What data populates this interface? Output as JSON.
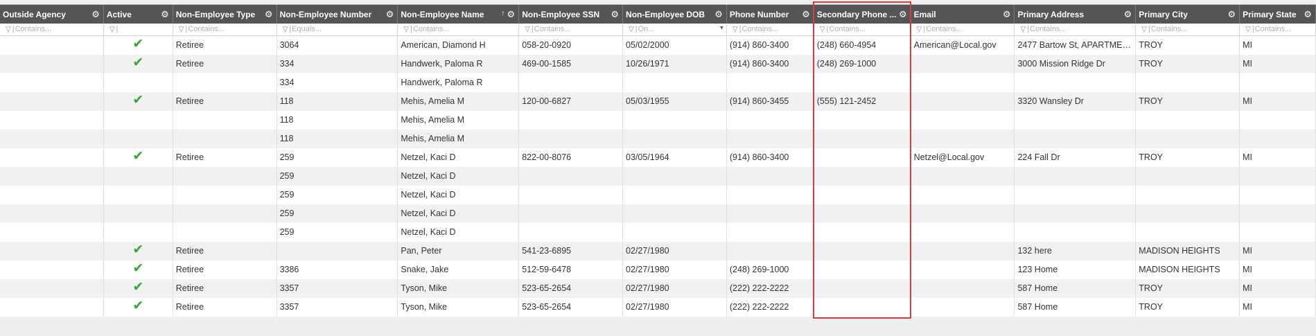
{
  "columns": [
    {
      "label": "Outside Agency",
      "filter": "Contains..."
    },
    {
      "label": "Active",
      "filter": ""
    },
    {
      "label": "Non-Employee Type",
      "filter": "Contains..."
    },
    {
      "label": "Non-Employee Number",
      "filter": "Equals..."
    },
    {
      "label": "Non-Employee Name",
      "filter": "Contains..."
    },
    {
      "label": "Non-Employee SSN",
      "filter": "Contains..."
    },
    {
      "label": "Non-Employee DOB",
      "filter": "On..."
    },
    {
      "label": "Phone Number",
      "filter": "Contains..."
    },
    {
      "label": "Secondary Phone ...",
      "filter": "Contains..."
    },
    {
      "label": "Email",
      "filter": "Contains..."
    },
    {
      "label": "Primary Address",
      "filter": "Contains..."
    },
    {
      "label": "Primary City",
      "filter": "Contains..."
    },
    {
      "label": "Primary State",
      "filter": "Contains..."
    }
  ],
  "rows": [
    {
      "agency": "",
      "active": true,
      "type": "Retiree",
      "number": "3064",
      "name": "American, Diamond H",
      "ssn": "058-20-0920",
      "dob": "05/02/2000",
      "phone": "(914) 860-3400",
      "phone2": "(248) 660-4954",
      "email": "American@Local.gov",
      "address": "2477 Bartow St, APARTMENT ...",
      "city": "TROY",
      "state": "MI"
    },
    {
      "agency": "",
      "active": true,
      "type": "Retiree",
      "number": "334",
      "name": "Handwerk, Paloma R",
      "ssn": "469-00-1585",
      "dob": "10/26/1971",
      "phone": "(914) 860-3400",
      "phone2": "(248) 269-1000",
      "email": "",
      "address": "3000 Mission Ridge Dr",
      "city": "TROY",
      "state": "MI"
    },
    {
      "agency": "",
      "active": false,
      "type": "",
      "number": "334",
      "name": "Handwerk, Paloma R",
      "ssn": "",
      "dob": "",
      "phone": "",
      "phone2": "",
      "email": "",
      "address": "",
      "city": "",
      "state": ""
    },
    {
      "agency": "",
      "active": true,
      "type": "Retiree",
      "number": "118",
      "name": "Mehis, Amelia M",
      "ssn": "120-00-6827",
      "dob": "05/03/1955",
      "phone": "(914) 860-3455",
      "phone2": "(555) 121-2452",
      "email": "",
      "address": "3320 Wansley Dr",
      "city": "TROY",
      "state": "MI"
    },
    {
      "agency": "",
      "active": false,
      "type": "",
      "number": "118",
      "name": "Mehis, Amelia M",
      "ssn": "",
      "dob": "",
      "phone": "",
      "phone2": "",
      "email": "",
      "address": "",
      "city": "",
      "state": ""
    },
    {
      "agency": "",
      "active": false,
      "type": "",
      "number": "118",
      "name": "Mehis, Amelia M",
      "ssn": "",
      "dob": "",
      "phone": "",
      "phone2": "",
      "email": "",
      "address": "",
      "city": "",
      "state": ""
    },
    {
      "agency": "",
      "active": true,
      "type": "Retiree",
      "number": "259",
      "name": "Netzel, Kaci D",
      "ssn": "822-00-8076",
      "dob": "03/05/1964",
      "phone": "(914) 860-3400",
      "phone2": "",
      "email": "Netzel@Local.gov",
      "address": "224 Fall Dr",
      "city": "TROY",
      "state": "MI"
    },
    {
      "agency": "",
      "active": false,
      "type": "",
      "number": "259",
      "name": "Netzel, Kaci D",
      "ssn": "",
      "dob": "",
      "phone": "",
      "phone2": "",
      "email": "",
      "address": "",
      "city": "",
      "state": ""
    },
    {
      "agency": "",
      "active": false,
      "type": "",
      "number": "259",
      "name": "Netzel, Kaci D",
      "ssn": "",
      "dob": "",
      "phone": "",
      "phone2": "",
      "email": "",
      "address": "",
      "city": "",
      "state": ""
    },
    {
      "agency": "",
      "active": false,
      "type": "",
      "number": "259",
      "name": "Netzel, Kaci D",
      "ssn": "",
      "dob": "",
      "phone": "",
      "phone2": "",
      "email": "",
      "address": "",
      "city": "",
      "state": ""
    },
    {
      "agency": "",
      "active": false,
      "type": "",
      "number": "259",
      "name": "Netzel, Kaci D",
      "ssn": "",
      "dob": "",
      "phone": "",
      "phone2": "",
      "email": "",
      "address": "",
      "city": "",
      "state": ""
    },
    {
      "agency": "",
      "active": true,
      "type": "Retiree",
      "number": "",
      "name": "Pan, Peter",
      "ssn": "541-23-6895",
      "dob": "02/27/1980",
      "phone": "",
      "phone2": "",
      "email": "",
      "address": "132 here",
      "city": "MADISON HEIGHTS",
      "state": "MI"
    },
    {
      "agency": "",
      "active": true,
      "type": "Retiree",
      "number": "3386",
      "name": "Snake, Jake",
      "ssn": "512-59-6478",
      "dob": "02/27/1980",
      "phone": "(248) 269-1000",
      "phone2": "",
      "email": "",
      "address": "123 Home",
      "city": "MADISON HEIGHTS",
      "state": "MI"
    },
    {
      "agency": "",
      "active": true,
      "type": "Retiree",
      "number": "3357",
      "name": "Tyson, Mike",
      "ssn": "523-65-2654",
      "dob": "02/27/1980",
      "phone": "(222) 222-2222",
      "phone2": "",
      "email": "",
      "address": "587 Home",
      "city": "TROY",
      "state": "MI"
    },
    {
      "agency": "",
      "active": true,
      "type": "Retiree",
      "number": "3357",
      "name": "Tyson, Mike",
      "ssn": "523-65-2654",
      "dob": "02/27/1980",
      "phone": "(222) 222-2222",
      "phone2": "",
      "email": "",
      "address": "587 Home",
      "city": "TROY",
      "state": "MI"
    }
  ],
  "icons": {
    "gear": "gear-icon",
    "filter": "filter-icon",
    "sort": "sort-ascending-icon",
    "check": "checkmark-icon",
    "dropdown": "dropdown-arrow-icon"
  },
  "colors": {
    "header_bg": "#555555",
    "check": "#3aa63a",
    "highlight": "#e0393e"
  }
}
